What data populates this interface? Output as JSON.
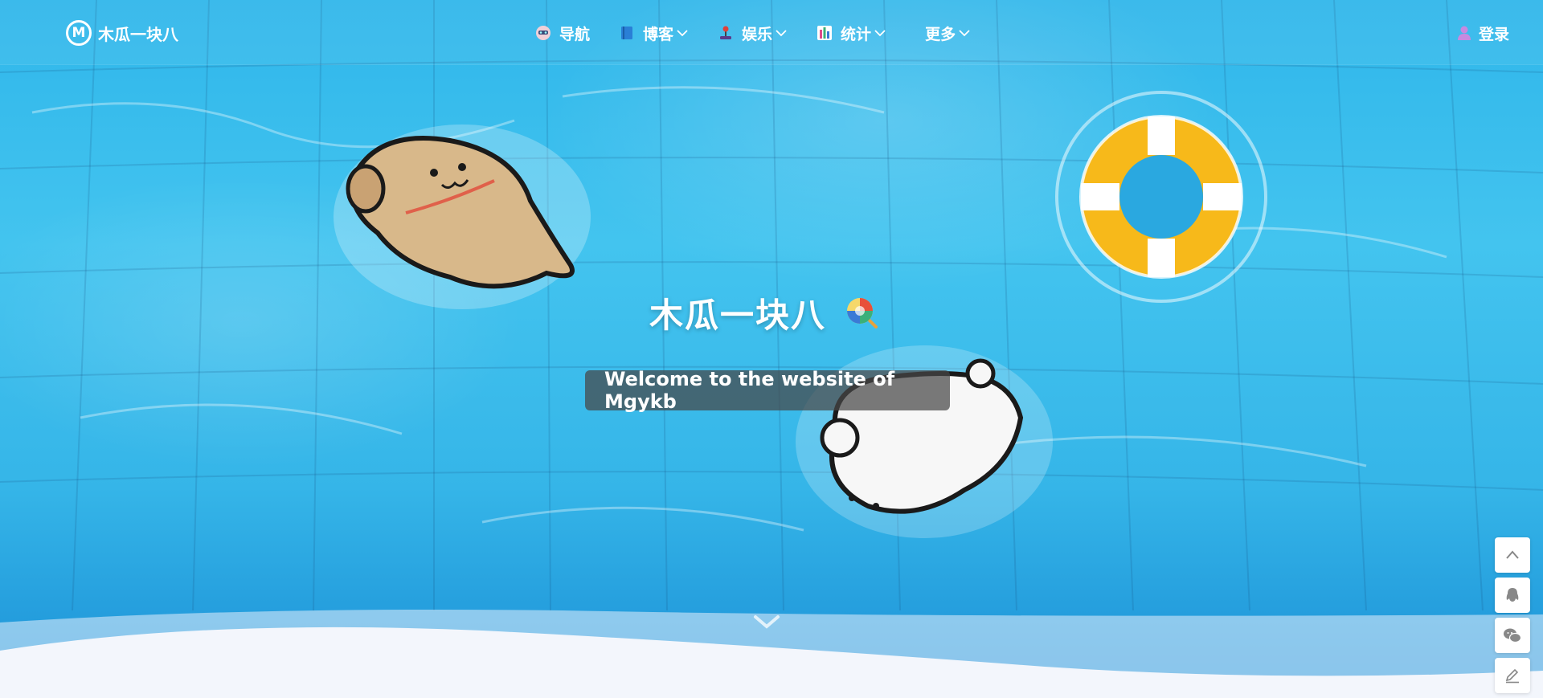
{
  "brand": {
    "logo_letter": "M",
    "name": "木瓜一块八"
  },
  "nav": {
    "items": [
      {
        "label": "导航",
        "icon": "robot-face-icon",
        "has_dropdown": false
      },
      {
        "label": "博客",
        "icon": "blue-book-icon",
        "has_dropdown": true
      },
      {
        "label": "娱乐",
        "icon": "joystick-icon",
        "has_dropdown": true
      },
      {
        "label": "统计",
        "icon": "bar-chart-icon",
        "has_dropdown": true
      },
      {
        "label": "更多",
        "icon": "",
        "has_dropdown": true
      }
    ],
    "login_label": "登录",
    "login_icon": "user-icon"
  },
  "hero": {
    "title": "木瓜一块八",
    "title_emoji": "lollipop-icon",
    "subtitle": "Welcome to the website of Mgykb"
  },
  "side_tools": [
    "arrow-up-icon",
    "qq-penguin-icon",
    "wechat-icon",
    "edit-pen-icon"
  ],
  "colors": {
    "water": "#35b5e8",
    "page_bg": "#f3f6fc",
    "accent": "#ffffff"
  }
}
